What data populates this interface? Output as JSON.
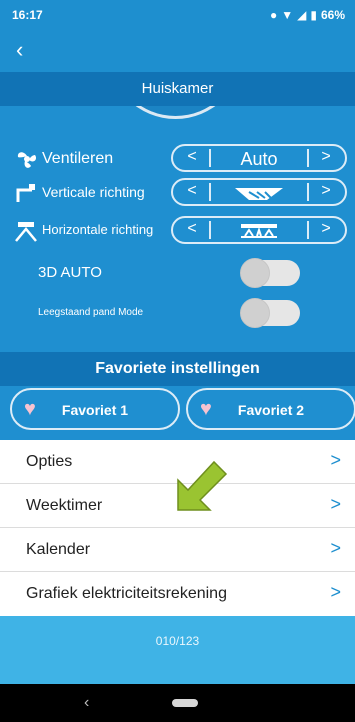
{
  "status_bar": {
    "time": "16:17",
    "battery": "66%"
  },
  "header": {
    "title": "Huiskamer"
  },
  "controls": {
    "fan": {
      "label": "Ventileren",
      "value": "Auto"
    },
    "vertical": {
      "label": "Verticale richting"
    },
    "horizontal": {
      "label": "Horizontale richting"
    },
    "auto3d": {
      "label": "3D AUTO"
    },
    "vacant": {
      "label": "Leegstaand pand Mode"
    }
  },
  "favorites": {
    "title": "Favoriete instellingen",
    "items": [
      {
        "label": "Favoriet 1"
      },
      {
        "label": "Favoriet 2"
      }
    ]
  },
  "menu": {
    "items": [
      {
        "label": "Opties"
      },
      {
        "label": "Weektimer"
      },
      {
        "label": "Kalender"
      },
      {
        "label": "Grafiek elektriciteitsrekening"
      }
    ]
  },
  "footer": {
    "code": "010/123"
  },
  "icons": {
    "back": "back-icon",
    "fan": "fan-icon",
    "vertical": "vertical-louver-icon",
    "horizontal": "horizontal-louver-icon",
    "heart": "heart-icon",
    "chevron": "chevron-right-icon"
  },
  "colors": {
    "primary": "#1f8fd0",
    "dark": "#1173b5",
    "footer": "#3fb3e6",
    "annotation_arrow": "#9ac431"
  }
}
